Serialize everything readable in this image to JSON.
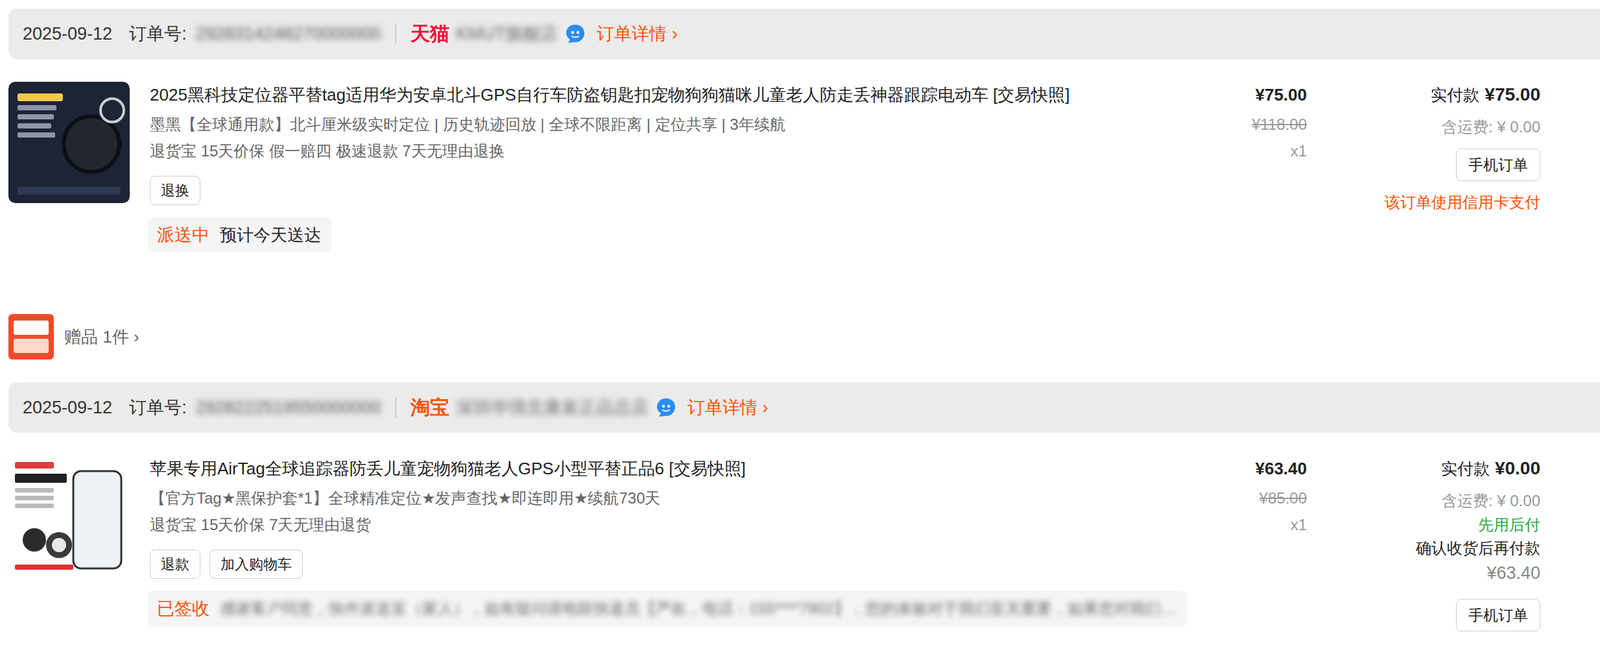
{
  "orders": [
    {
      "date": "2025-09-12",
      "order_label": "订单号:",
      "order_no": {
        "text": "2928314246270000000",
        "blurred": true
      },
      "platform": {
        "name": "天猫",
        "color": "#ff0036"
      },
      "shop": {
        "text": "KMUT旗舰店",
        "blurred": true
      },
      "detail_link": "订单详情 ›",
      "item": {
        "title": "2025黑科技定位器平替tag适用华为安卓北斗GPS自行车防盗钥匙扣宠物狗狗猫咪儿童老人防走丢神器跟踪电动车 [交易快照]",
        "spec": "墨黑【全球通用款】北斗厘米级实时定位 | 历史轨迹回放 | 全球不限距离 | 定位共享 | 3年续航",
        "services": "退货宝 15天价保 假一赔四 极速退款 7天无理由退换",
        "price": "¥75.00",
        "original_price": "¥118.00",
        "qty": "x1",
        "actions": [
          "退换"
        ],
        "image": "dark"
      },
      "status": {
        "label": "派送中",
        "text": "预计今天送达",
        "blurred": false
      },
      "payment": {
        "label": "实付款",
        "amount": "¥75.00",
        "shipping": "含运费: ¥ 0.00",
        "notes_before": [],
        "button": "手机订单",
        "notes_after": [
          {
            "text": "该订单使用信用卡支付",
            "kind": "alert"
          }
        ]
      },
      "gift": "赠品 1件 ›"
    },
    {
      "date": "2025-09-12",
      "order_label": "订单号:",
      "order_no": {
        "text": "2928222519550000000",
        "blurred": true
      },
      "platform": {
        "name": "淘宝",
        "color": "#ff5000"
      },
      "shop": {
        "text": "深圳华强北康泉正品总店",
        "blurred": true
      },
      "detail_link": "订单详情 ›",
      "item": {
        "title": "苹果专用AirTag全球追踪器防丢儿童宠物狗猫老人GPS小型平替正品6 [交易快照]",
        "spec": "【官方Tag★黑保护套*1】全球精准定位★发声查找★即连即用★续航730天",
        "services": "退货宝 15天价保 7天无理由退货",
        "price": "¥63.40",
        "original_price": "¥85.00",
        "qty": "x1",
        "actions": [
          "退款",
          "加入购物车"
        ],
        "image": "light"
      },
      "status": {
        "label": "已签收",
        "text": "感谢客户同意，快件派送至（家人），如有疑问请电联快递员【严欢，电话：155****7902】，您的体验对于我们至关重要，如果您对我们…",
        "blurred": true
      },
      "payment": {
        "label": "实付款",
        "amount": "¥0.00",
        "shipping": "含运费: ¥ 0.00",
        "notes_before": [
          {
            "text": "先用后付",
            "kind": "green"
          },
          {
            "text": "确认收货后再付款",
            "kind": "hint"
          },
          {
            "text": "¥63.40",
            "kind": "due"
          }
        ],
        "button": "手机订单",
        "notes_after": []
      }
    }
  ]
}
